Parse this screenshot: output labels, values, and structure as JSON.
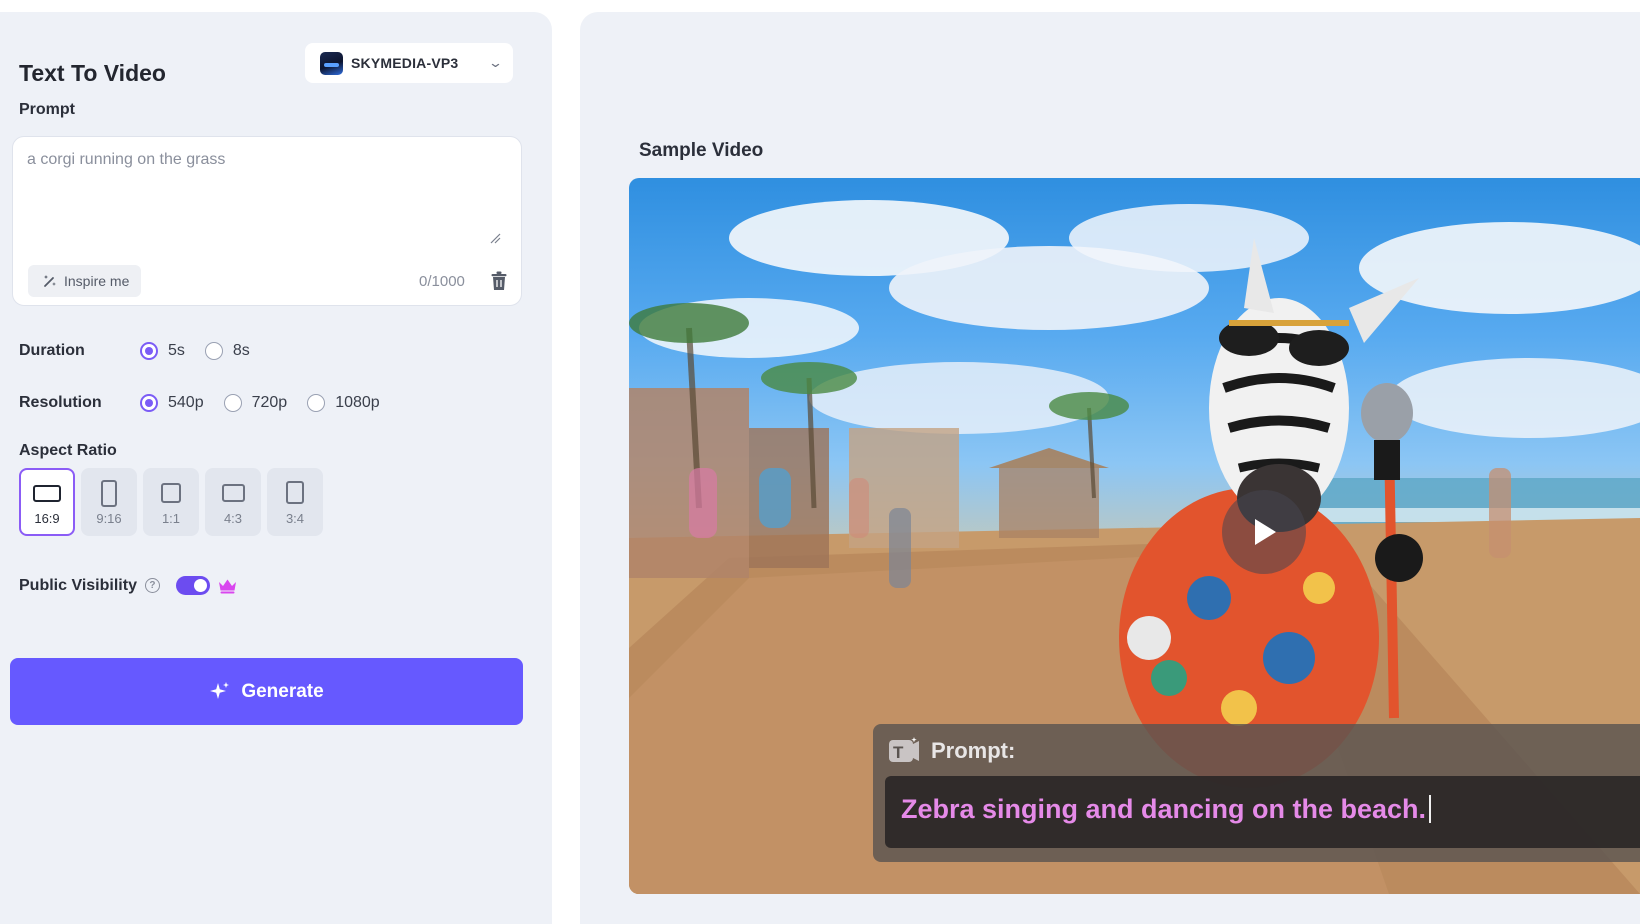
{
  "panel": {
    "title": "Text To Video",
    "model_select": {
      "label": "SKYMEDIA-VP3"
    },
    "prompt": {
      "label": "Prompt",
      "value": "",
      "placeholder": "a corgi running on the grass",
      "inspire_label": "Inspire me",
      "char_count": "0/1000"
    },
    "duration": {
      "label": "Duration",
      "options": [
        "5s",
        "8s"
      ],
      "selected": "5s"
    },
    "resolution": {
      "label": "Resolution",
      "options": [
        "540p",
        "720p",
        "1080p"
      ],
      "selected": "540p"
    },
    "aspect_ratio": {
      "label": "Aspect Ratio",
      "options": [
        "16:9",
        "9:16",
        "1:1",
        "4:3",
        "3:4"
      ],
      "selected": "16:9"
    },
    "public_visibility": {
      "label": "Public Visibility",
      "help_icon": "?",
      "enabled": true,
      "premium_icon": "crown-icon"
    },
    "generate_label": "Generate"
  },
  "sample": {
    "title": "Sample Video",
    "play_icon": "play-icon",
    "prompt_label": "Prompt:",
    "prompt_text": "Zebra singing and dancing on the beach."
  },
  "colors": {
    "accent": "#6659ff",
    "radio_on": "#7b5cf6",
    "panel_bg": "#eef1f7",
    "overlay_text": "#e58ae8"
  }
}
